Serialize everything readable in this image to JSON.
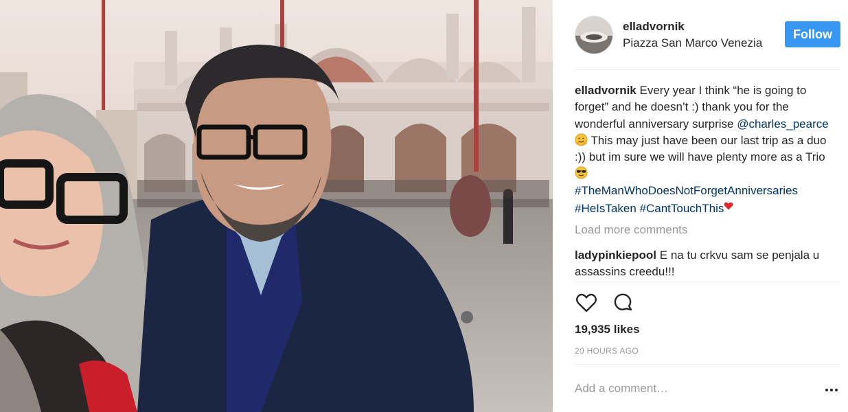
{
  "post": {
    "username": "elladvornik",
    "location": "Piazza San Marco Venezia",
    "follow_label": "Follow"
  },
  "caption": {
    "username": "elladvornik",
    "text_1": " Every year I think “he is going to forget” and he doesn’t :) thank you for the wonderful anniversary surprise ",
    "mention": "@charles_pearce",
    "text_2": " This may just have been our last trip as a duo :)) but im sure we will have plenty more as a Trio ",
    "hashtag_1": "#TheManWhoDoesNotForgetAnniversaries",
    "hashtag_2": "#HeIsTaken",
    "hashtag_3": "#CantTouchThis"
  },
  "load_more_label": "Load more comments",
  "comment": {
    "username": "ladypinkiepool",
    "text": " E na tu crkvu sam se penjala u assassins creedu!!!"
  },
  "likes": "19,935 likes",
  "timestamp": "20 HOURS AGO",
  "add_comment_placeholder": "Add a comment…",
  "icons": {
    "like": "heart-icon",
    "comment": "comment-icon",
    "more": "more-options-icon",
    "emoji_1": "hugging-face-emoji",
    "emoji_2": "sunglasses-emoji",
    "emoji_3": "heart-emoji"
  },
  "colors": {
    "follow": "#3897f0",
    "link": "#003569",
    "muted": "#999999"
  }
}
